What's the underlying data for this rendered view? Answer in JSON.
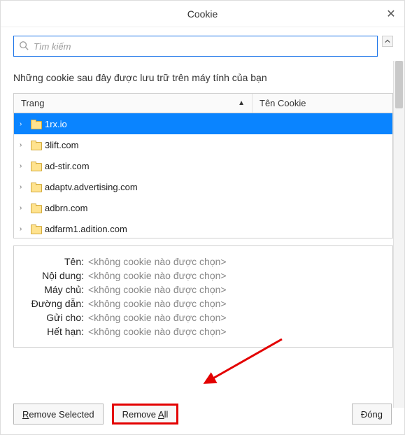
{
  "window": {
    "title": "Cookie"
  },
  "search": {
    "placeholder": "Tìm kiếm"
  },
  "description": "Những cookie sau đây được lưu trữ trên máy tính của bạn",
  "columns": {
    "trang": "Trang",
    "ten": "Tên Cookie"
  },
  "rows": [
    {
      "site": "1rx.io",
      "selected": true
    },
    {
      "site": "3lift.com",
      "selected": false
    },
    {
      "site": "ad-stir.com",
      "selected": false
    },
    {
      "site": "adaptv.advertising.com",
      "selected": false
    },
    {
      "site": "adbrn.com",
      "selected": false
    },
    {
      "site": "adfarm1.adition.com",
      "selected": false
    }
  ],
  "details": {
    "none_selected": "<không cookie nào được chọn>",
    "labels": {
      "ten": "Tên:",
      "noidung": "Nội dung:",
      "maychu": "Máy chủ:",
      "duongdan": "Đường dẫn:",
      "guicho": "Gửi cho:",
      "hethan": "Hết hạn:"
    }
  },
  "buttons": {
    "remove_selected_pre": "R",
    "remove_selected_rest": "emove Selected",
    "remove_all_pre": "Remove ",
    "remove_all_u": "A",
    "remove_all_rest": "ll",
    "close": "Đóng"
  }
}
